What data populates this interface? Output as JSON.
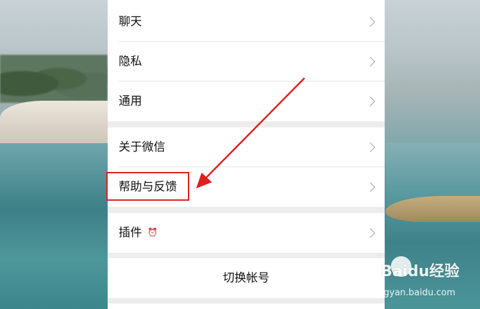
{
  "settings": {
    "items": [
      {
        "label": "聊天"
      },
      {
        "label": "隐私"
      },
      {
        "label": "通用"
      },
      {
        "label": "关于微信"
      },
      {
        "label": "帮助与反馈"
      },
      {
        "label": "插件"
      }
    ],
    "switch_account_label": "切换帐号"
  },
  "watermark": {
    "brand": "Baidu经验",
    "url": "jingyan.baidu.com"
  },
  "colors": {
    "highlight": "#e01e1e",
    "arrow": "#e01e1e"
  }
}
